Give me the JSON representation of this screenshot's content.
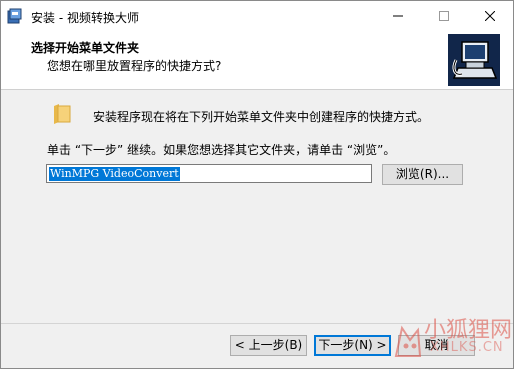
{
  "window": {
    "title": "安装 - 视频转换大师"
  },
  "header": {
    "title": "选择开始菜单文件夹",
    "subtitle": "您想在哪里放置程序的快捷方式?"
  },
  "body": {
    "text1": "安装程序现在将在下列开始菜单文件夹中创建程序的快捷方式。",
    "text2": "单击 “下一步” 继续。如果您想选择其它文件夹，请单击 “浏览”。",
    "folder_value": "WinMPG VideoConvert",
    "browse_label": "浏览(R)..."
  },
  "footer": {
    "back_label": "< 上一步(B)",
    "next_label": "下一步(N) >",
    "cancel_label": "取消"
  },
  "watermark": {
    "text1": "小狐狸网",
    "text2": "XHLKS.CN"
  },
  "colors": {
    "selection": "#0078d7",
    "watermark": "#dc5046"
  }
}
